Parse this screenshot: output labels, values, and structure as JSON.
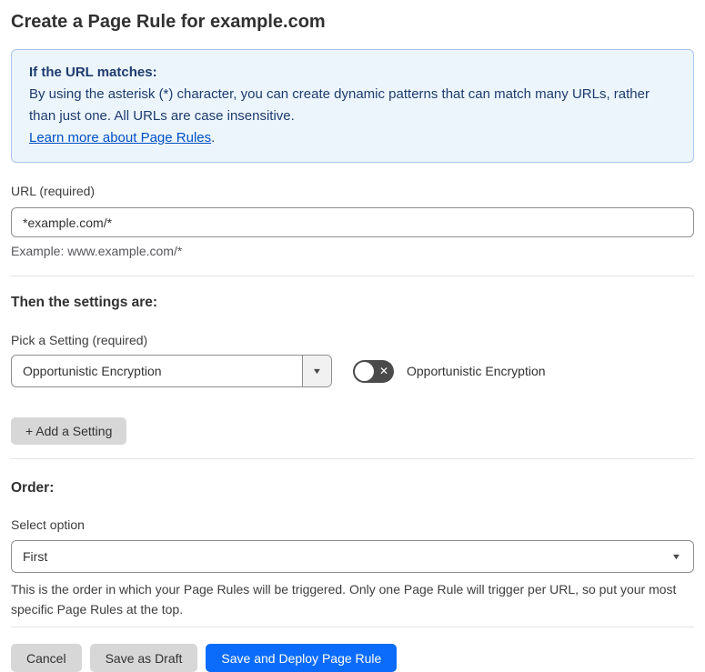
{
  "page": {
    "title": "Create a Page Rule for example.com"
  },
  "info_box": {
    "heading": "If the URL matches:",
    "body": "By using the asterisk (*) character, you can create dynamic patterns that can match many URLs, rather than just one. All URLs are case insensitive.",
    "link_text": "Learn more about Page Rules",
    "link_suffix": "."
  },
  "url_field": {
    "label": "URL (required)",
    "value": "*example.com/*",
    "example": "Example: www.example.com/*"
  },
  "settings_section": {
    "heading": "Then the settings are:",
    "picker_label": "Pick a Setting (required)",
    "picker_value": "Opportunistic Encryption",
    "toggle_label": "Opportunistic Encryption",
    "toggle_state": "off",
    "add_setting_label": "+ Add a Setting"
  },
  "order_section": {
    "heading": "Order:",
    "select_label": "Select option",
    "select_value": "First",
    "help_text": "This is the order in which your Page Rules will be triggered. Only one Page Rule will trigger per URL, so put your most specific Page Rules at the top."
  },
  "footer": {
    "cancel_label": "Cancel",
    "save_draft_label": "Save as Draft",
    "save_deploy_label": "Save and Deploy Page Rule"
  },
  "icons": {
    "dropdown_arrow": "▼",
    "toggle_x": "✕"
  },
  "colors": {
    "accent_blue": "#0b6cfb",
    "link_blue": "#0051c3",
    "info_bg": "#edf5fc",
    "info_border": "#a9c6ea",
    "info_text": "#1d3c6e",
    "toggle_off_bg": "#4a4a4a"
  }
}
